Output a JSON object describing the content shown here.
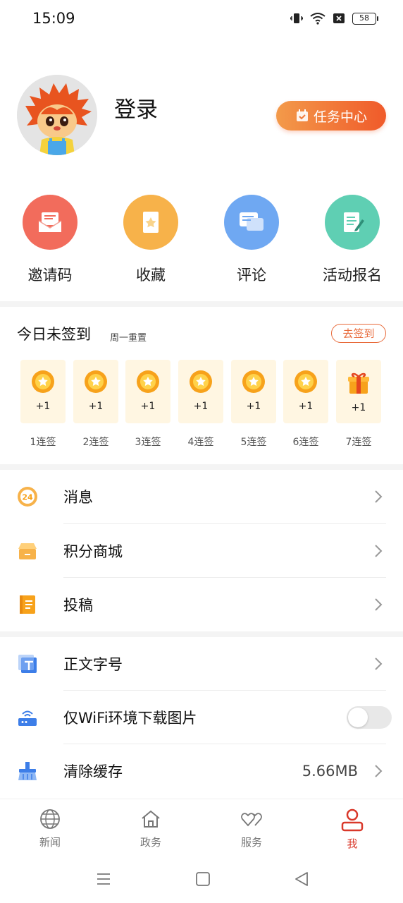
{
  "status_bar": {
    "time": "15:09",
    "battery": "58"
  },
  "profile": {
    "login_label": "登录",
    "task_center_label": "任务中心"
  },
  "shortcuts": [
    {
      "label": "邀请码",
      "icon": "envelope-icon",
      "color": "#f26c5c"
    },
    {
      "label": "收藏",
      "icon": "bookmark-star-icon",
      "color": "#f7b24a"
    },
    {
      "label": "评论",
      "icon": "chat-bubbles-icon",
      "color": "#6fa8f2"
    },
    {
      "label": "活动报名",
      "icon": "form-pen-icon",
      "color": "#5fcfb3"
    }
  ],
  "signin": {
    "title": "今日未签到",
    "subtitle": "周一重置",
    "button": "去签到",
    "days": [
      {
        "reward": "+1",
        "label": "1连签",
        "icon": "gold-coin-icon"
      },
      {
        "reward": "+1",
        "label": "2连签",
        "icon": "gold-coin-icon"
      },
      {
        "reward": "+1",
        "label": "3连签",
        "icon": "gold-coin-icon"
      },
      {
        "reward": "+1",
        "label": "4连签",
        "icon": "gold-coin-icon"
      },
      {
        "reward": "+1",
        "label": "5连签",
        "icon": "gold-coin-icon"
      },
      {
        "reward": "+1",
        "label": "6连签",
        "icon": "gold-coin-icon"
      },
      {
        "reward": "+1",
        "label": "7连签",
        "icon": "gift-box-icon"
      }
    ]
  },
  "menu_group1": [
    {
      "label": "消息",
      "icon": "badge-24-icon"
    },
    {
      "label": "积分商城",
      "icon": "shop-icon"
    },
    {
      "label": "投稿",
      "icon": "notebook-icon"
    }
  ],
  "menu_group2": [
    {
      "label": "正文字号",
      "icon": "text-size-icon"
    },
    {
      "label": "仅WiFi环境下载图片",
      "icon": "wifi-router-icon",
      "toggle": false
    },
    {
      "label": "清除缓存",
      "icon": "broom-icon",
      "value": "5.66MB"
    }
  ],
  "tabs": [
    {
      "label": "新闻",
      "icon": "globe-icon",
      "active": false
    },
    {
      "label": "政务",
      "icon": "home-icon",
      "active": false
    },
    {
      "label": "服务",
      "icon": "hearts-icon",
      "active": false
    },
    {
      "label": "我",
      "icon": "user-icon",
      "active": true
    }
  ],
  "colors": {
    "accent": "#d9382a",
    "orange": "#f05a2a"
  }
}
